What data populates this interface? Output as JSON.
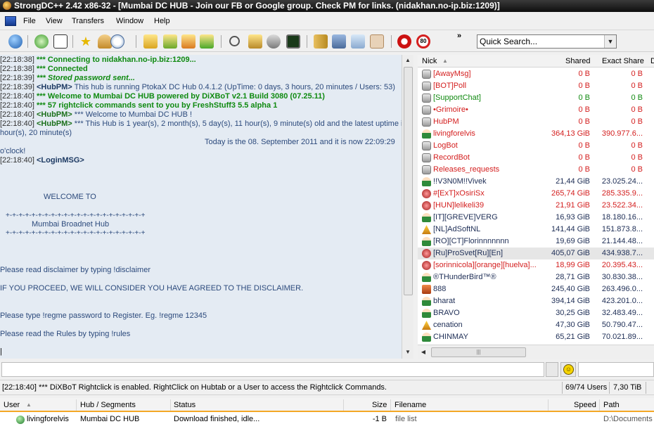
{
  "window": {
    "title": "StrongDC++ 2.42 x86-32 - [Mumbai DC HUB - Join our FB or Google group. Check PM for links. (nidakhan.no-ip.biz:1209)]"
  },
  "menu": [
    "File",
    "View",
    "Transfers",
    "Window",
    "Help"
  ],
  "toolbar": {
    "icons": [
      "connect-icon",
      "reconnect-icon",
      "follow-redirect-icon",
      "favorites-icon",
      "users-icon",
      "recent-hubs-icon",
      "queue-icon",
      "finished-icon",
      "upload-queue-icon",
      "finished-uploads-icon",
      "search-icon",
      "adl-search-icon",
      "search-spy-icon",
      "notepad-icon",
      "open-filelist-icon",
      "settings-icon",
      "network-stats-icon",
      "limiter-icon",
      "stop-icon",
      "speed-limit-icon"
    ],
    "chevron": "»",
    "quick_search_placeholder": "Quick Search..."
  },
  "chat": {
    "lines": [
      {
        "ts": "[22:18:38]",
        "text": "*** Connecting to nidakhan.no-ip.biz:1209...",
        "style": "sys"
      },
      {
        "ts": "[22:18:38]",
        "text": "*** Connected",
        "style": "sys"
      },
      {
        "ts": "[22:18:39]",
        "text": "*** Stored password sent...",
        "style": "sys"
      },
      {
        "ts": "[22:18:39]",
        "nick": "<HubPM>",
        "text": " This hub is running PtokaX DC Hub 0.4.1.2 (UpTime: 0 days, 3 hours, 20 minutes / Users: 53)",
        "style": "normal"
      },
      {
        "ts": "[22:18:40]",
        "text": "*** Welcome to Mumbai DC HUB powered by DiXBoT v2.1 Build 3080 (07.25.11)",
        "style": "sys"
      },
      {
        "ts": "[22:18:40]",
        "text": "*** 57 rightclick commands sent to you by FreshStuff3 5.5 alpha 1",
        "style": "sys"
      },
      {
        "ts": "[22:18:40]",
        "nick": "<HubPM>",
        "text": " *** Welcome to Mumbai DC HUB !",
        "style": "normal"
      },
      {
        "ts": "[22:18:40]",
        "nick": "<HubPM>",
        "text": " *** This Hub is 1 year(s), 2 month(s), 5 day(s), 11 hour(s), 9 minute(s) old and the latest uptime is 3",
        "style": "normal"
      }
    ],
    "wrap_line": "hour(s), 20 minute(s)",
    "date_line": "Today is the 08. September 2011 and it is now 22:09:29",
    "oclock": "o'clock!",
    "login_ts": "[22:18:40]",
    "login_nick": "<LoginMSG>",
    "welcome": "WELCOME TO",
    "plus_line": "+-+-+-+-+-+-+-+-+-+-+-+-+-+-+-+-+-+-+-+-+-+",
    "hub_name": "Mumbai Broadnet Hub",
    "disclaimer": "Please read disclaimer by typing  !disclaimer",
    "proceed": "IF YOU PROCEED, WE WILL CONSIDER YOU HAVE AGREED TO THE DISCLAIMER.",
    "register": "Please type !regme password to Register. Eg. !regme 12345",
    "rules": "Please read the Rules by typing !rules",
    "cursor": "|"
  },
  "userlist": {
    "columns": {
      "nick": "Nick",
      "shared": "Shared",
      "exact": "Exact Share",
      "extra": "D"
    },
    "rows": [
      {
        "nick": "[AwayMsg]",
        "shared": "0 B",
        "exact": "0 B",
        "extra": "",
        "color": "red",
        "icon": "bot-icon"
      },
      {
        "nick": "[BOT]Poll",
        "shared": "0 B",
        "exact": "0 B",
        "extra": "",
        "color": "red",
        "icon": "bot-icon"
      },
      {
        "nick": "[SupportChat]",
        "shared": "0 B",
        "exact": "0 B",
        "extra": "",
        "color": "green",
        "icon": "bot-icon"
      },
      {
        "nick": "•Grimoire•",
        "shared": "0 B",
        "exact": "0 B",
        "extra": "",
        "color": "red",
        "icon": "bot-icon"
      },
      {
        "nick": "HubPM",
        "shared": "0 B",
        "exact": "0 B",
        "extra": "",
        "color": "red",
        "icon": "bot-icon"
      },
      {
        "nick": "livingforelvis",
        "shared": "364,13 GiB",
        "exact": "390.977.6...",
        "extra": "",
        "color": "red",
        "icon": "user-icon"
      },
      {
        "nick": "LogBot",
        "shared": "0 B",
        "exact": "0 B",
        "extra": "",
        "color": "red",
        "icon": "bot-icon"
      },
      {
        "nick": "RecordBot",
        "shared": "0 B",
        "exact": "0 B",
        "extra": "",
        "color": "red",
        "icon": "bot-icon"
      },
      {
        "nick": "Releases_requests",
        "shared": "0 B",
        "exact": "0 B",
        "extra": "",
        "color": "red",
        "icon": "bot-icon"
      },
      {
        "nick": "!!V3N0M!!Vivek",
        "shared": "21,44 GiB",
        "exact": "23.025.24...",
        "extra": "",
        "color": "dark",
        "icon": "user-icon"
      },
      {
        "nick": "#[ExT]xOsiriSx",
        "shared": "265,74 GiB",
        "exact": "285.335.9...",
        "extra": "",
        "color": "red",
        "icon": "op-icon"
      },
      {
        "nick": "[HUN]lelikeli39",
        "shared": "21,91 GiB",
        "exact": "23.522.34...",
        "extra": "",
        "color": "red",
        "icon": "op-icon"
      },
      {
        "nick": "[IT][GREVE]VERG",
        "shared": "16,93 GiB",
        "exact": "18.180.16...",
        "extra": "",
        "color": "dark",
        "icon": "user-icon"
      },
      {
        "nick": "[NL]AdSoftNL",
        "shared": "141,44 GiB",
        "exact": "151.873.8...",
        "extra": "",
        "color": "dark",
        "icon": "warn-icon"
      },
      {
        "nick": "[RO][CT]Florinnnnnnn",
        "shared": "19,69 GiB",
        "exact": "21.144.48...",
        "extra": "",
        "color": "dark",
        "icon": "user-icon"
      },
      {
        "nick": "[Ru]ProSvet[Ru][En]",
        "shared": "405,07 GiB",
        "exact": "434.938.7...",
        "extra": "",
        "color": "dark",
        "icon": "op-icon",
        "selected": true
      },
      {
        "nick": "[sorinnicola][orange][huelva]...",
        "shared": "18,99 GiB",
        "exact": "20.395.43...",
        "extra": "",
        "color": "red",
        "icon": "op-icon"
      },
      {
        "nick": "®THunderBird™®",
        "shared": "28,71 GiB",
        "exact": "30.830.38...",
        "extra": "",
        "color": "dark",
        "icon": "user-icon"
      },
      {
        "nick": "888",
        "shared": "245,40 GiB",
        "exact": "263.496.0...",
        "extra": "",
        "color": "dark",
        "icon": "box-icon"
      },
      {
        "nick": "bharat",
        "shared": "394,14 GiB",
        "exact": "423.201.0...",
        "extra": "",
        "color": "dark",
        "icon": "user-icon"
      },
      {
        "nick": "BRAVO",
        "shared": "30,25 GiB",
        "exact": "32.483.49...",
        "extra": "",
        "color": "dark",
        "icon": "user-icon"
      },
      {
        "nick": "cenation",
        "shared": "47,30 GiB",
        "exact": "50.790.47...",
        "extra": "",
        "color": "dark",
        "icon": "warn-icon"
      },
      {
        "nick": "CHINMAY",
        "shared": "65,21 GiB",
        "exact": "70.021.89...",
        "extra": "",
        "color": "dark",
        "icon": "user-icon"
      }
    ],
    "hscroll_grip": "|||"
  },
  "statusbar": {
    "message": "[22:18:40] *** DiXBoT Rightclick is enabled. RightClick on Hubtab or a User to access the Rightclick Commands.",
    "users": "69/74 Users",
    "share": "7,30 TiB"
  },
  "transfers": {
    "columns": {
      "user": "User",
      "hub": "Hub / Segments",
      "status": "Status",
      "size": "Size",
      "filename": "Filename",
      "speed": "Speed",
      "path": "Path"
    },
    "rows": [
      {
        "user": "livingforelvis",
        "hub": "Mumbai DC HUB",
        "status": "Download finished, idle...",
        "size": "-1 B",
        "filename": "file list",
        "speed": "",
        "path": "D:\\Documents"
      }
    ]
  },
  "colors": {
    "accent": "#f4a826",
    "chat_bg": "#e4ebf3",
    "op_red": "#d42020",
    "bot_green": "#128a12"
  }
}
